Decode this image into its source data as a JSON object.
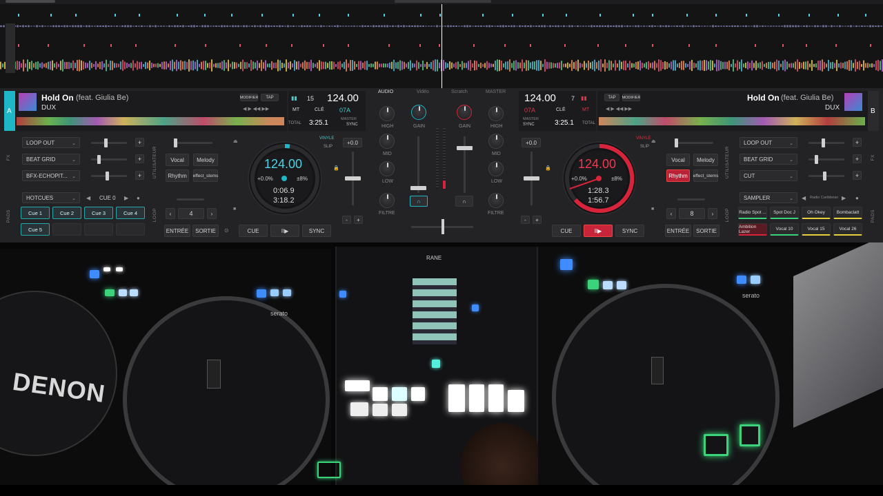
{
  "colors": {
    "accent_a": "#1fb6c8",
    "accent_b": "#d8243a",
    "panel": "#232326",
    "bg": "#0b0b0c"
  },
  "mixer_tabs": [
    "AUDIO",
    "Vidéo",
    "Scratch",
    "MASTER"
  ],
  "deck_a": {
    "letter": "A",
    "title": "Hold On",
    "feat": "(feat. Giulia Be)",
    "artist": "DUX",
    "modify": "MODIFIER",
    "tap": "TAP",
    "bpm": "124.00",
    "beat_num": "15",
    "mt": "MT",
    "key_label": "CLÉ",
    "key": "07A",
    "total_label": "TOTAL",
    "total": "3:25.1",
    "master_label": "MASTER",
    "sync_label": "SYNC",
    "vinyl": "VINYLE",
    "slip": "SLIP",
    "pitch": "+0.0",
    "jog_bpm": "124.00",
    "jog_pitch": "+0.0%",
    "jog_range": "±8%",
    "elapsed": "0:06.9",
    "remain": "3:18.2",
    "fx": [
      {
        "name": "LOOP OUT",
        "level": 0.4
      },
      {
        "name": "BEAT GRID",
        "level": 0.2
      },
      {
        "name": "BFX-ECHOPIT...",
        "level": 0.45
      }
    ],
    "stems": [
      "Vocal",
      "Melody",
      "Rhythm",
      "effect_stems"
    ],
    "pads_mode": "HOTCUES",
    "cue_label": "CUE 0",
    "pads": [
      "Cue 1",
      "Cue 2",
      "Cue 3",
      "Cue 4",
      "Cue 5"
    ],
    "loop_size": "4",
    "loop_in": "ENTRÉE",
    "loop_out": "SORTIE",
    "cue": "CUE",
    "play": "II▶",
    "sync": "SYNC",
    "tabs": {
      "fx": "FX",
      "user": "UTILISATEUR",
      "pads": "PADS",
      "loop": "LOOP"
    }
  },
  "deck_b": {
    "letter": "B",
    "title": "Hold On",
    "feat": "(feat. Giulia Be)",
    "artist": "DUX",
    "modify": "MODIFIER",
    "tap": "TAP",
    "bpm": "124.00",
    "beat_num": "7",
    "mt": "MT",
    "key_label": "CLÉ",
    "key": "07A",
    "total_label": "TOTAL",
    "total": "3:25.1",
    "master_label": "MASTER",
    "sync_label": "SYNC",
    "vinyl": "VINYLE",
    "slip": "SLIP",
    "pitch": "+0.0",
    "jog_bpm": "124.00",
    "jog_pitch": "+0.0%",
    "jog_range": "±8%",
    "elapsed": "1:28.3",
    "remain": "1:56.7",
    "fx": [
      {
        "name": "LOOP OUT",
        "level": 0.4
      },
      {
        "name": "BEAT GRID",
        "level": 0.2
      },
      {
        "name": "CUT",
        "level": 0.45
      }
    ],
    "stems": [
      "Vocal",
      "Melody",
      "Rhythm",
      "effect_stems"
    ],
    "pads_mode": "SAMPLER",
    "cue_label": "Radio Caribbean",
    "pads": [
      "Radio Spot ...",
      "Spot Doc J",
      "Oh Okey",
      "Bombaclatt",
      "Ambition Lazer",
      "Vocal 10",
      "Vocal 15",
      "Vocal 26"
    ],
    "loop_size": "8",
    "loop_in": "ENTRÉE",
    "loop_out": "SORTIE",
    "cue": "CUE",
    "play": "II▶",
    "sync": "SYNC",
    "tabs": {
      "fx": "FX",
      "user": "UTILISATEUR",
      "pads": "PADS",
      "loop": "LOOP"
    }
  },
  "mixer": {
    "high": "HIGH",
    "mid": "MID",
    "low": "LOW",
    "filter": "FILTRE",
    "gain": "GAIN",
    "headphone_icon": "headphones-icon"
  },
  "hardware": {
    "left_brand": "DENON",
    "serato": "serato",
    "rane": "RANE"
  }
}
